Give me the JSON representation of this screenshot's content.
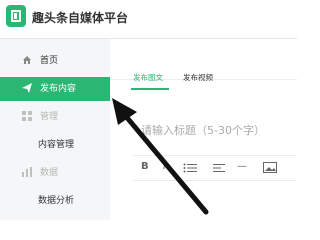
{
  "app": {
    "brand": "趣头条自媒体平台"
  },
  "sidebar": {
    "items": [
      {
        "label": "首页",
        "icon": "home-icon"
      },
      {
        "label": "发布内容",
        "icon": "send-icon",
        "active": true
      },
      {
        "label": "管理",
        "icon": "grid-icon",
        "group": true
      },
      {
        "label": "内容管理"
      },
      {
        "label": "数据",
        "icon": "bar-chart-icon",
        "group": true
      },
      {
        "label": "数据分析"
      }
    ]
  },
  "main": {
    "tabs": [
      {
        "label": "发布图文",
        "active": true
      },
      {
        "label": "发布视频"
      }
    ],
    "title_placeholder": "请输入标题（5-30个字）",
    "toolbar": [
      "B",
      "I",
      "list",
      "align",
      "—",
      "image"
    ]
  },
  "colors": {
    "accent": "#2bb673",
    "sidebar_bg": "#f5f6f8"
  }
}
